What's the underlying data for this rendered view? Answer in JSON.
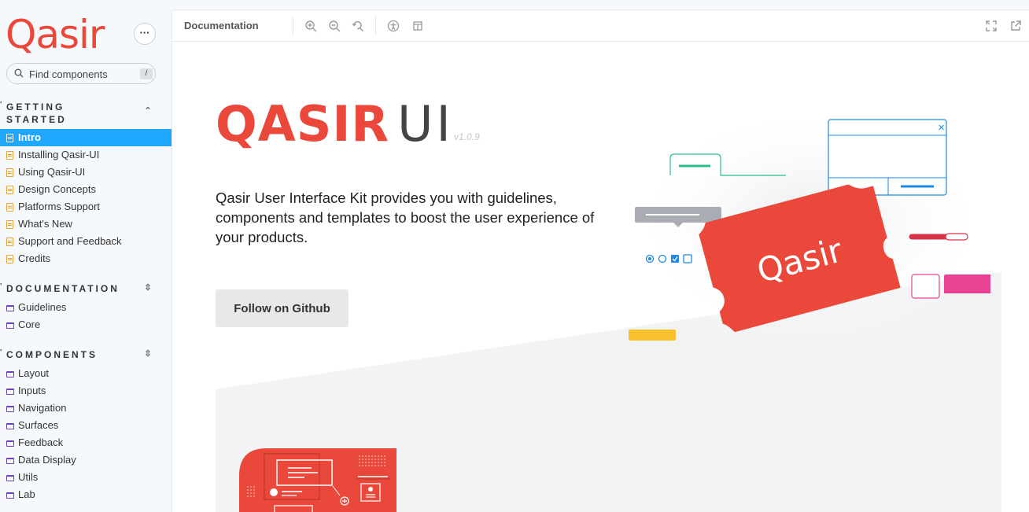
{
  "sidebar": {
    "logo": "Qasir",
    "search": {
      "placeholder": "Find components",
      "shortcut": "/"
    },
    "sections": [
      {
        "title_line1": "GETTING",
        "title_line2": "STARTED"
      },
      {
        "title": "DOCUMENTATION"
      },
      {
        "title": "COMPONENTS"
      }
    ],
    "getting_started": [
      "Intro",
      "Installing Qasir-UI",
      "Using Qasir-UI",
      "Design Concepts",
      "Platforms Support",
      "What's New",
      "Support and Feedback",
      "Credits"
    ],
    "documentation": [
      "Guidelines",
      "Core"
    ],
    "components": [
      "Layout",
      "Inputs",
      "Navigation",
      "Surfaces",
      "Feedback",
      "Data Display",
      "Utils",
      "Lab"
    ],
    "active_item": "Intro"
  },
  "toolbar": {
    "title": "Documentation",
    "icons": [
      "zoom-in-icon",
      "zoom-out-icon",
      "zoom-reset-icon",
      "accessibility-icon",
      "measure-icon",
      "fullscreen-icon",
      "open-new-tab-icon"
    ]
  },
  "hero": {
    "title_brand": "QASIR",
    "title_suffix": "UI",
    "version": "v1.0.9",
    "description": "Qasir User Interface Kit provides you with guidelines, components and templates to boost the user experience of your products.",
    "button": "Follow on Github",
    "illustration_logo": "Qasir"
  },
  "colors": {
    "brand": "#e9483b",
    "accent": "#1ea7fd",
    "folder": "#6f42c1",
    "doc": "#e8a33e"
  }
}
